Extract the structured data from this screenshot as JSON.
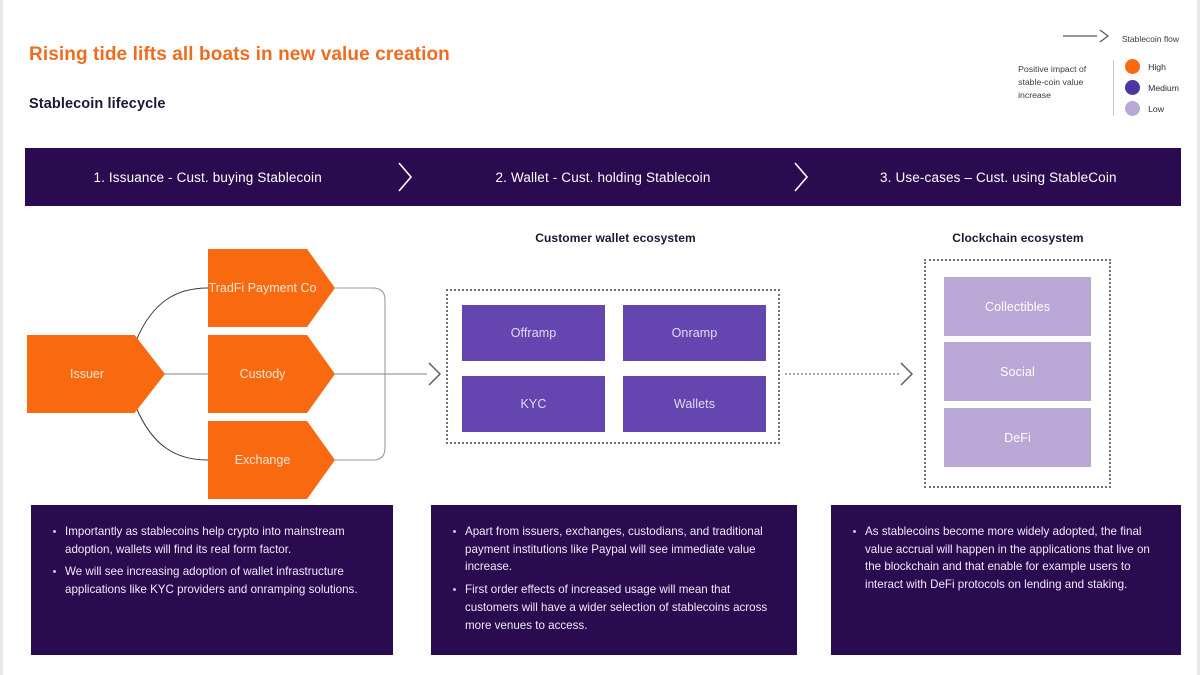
{
  "header": {
    "title": "Rising tide lifts all boats in new value creation",
    "subtitle": "Stablecoin lifecycle"
  },
  "legend": {
    "flow_label": "Stablecoin flow",
    "flow_icon": "arrow-right-chevron-icon",
    "impact_caption": "Positive impact of stable-coin value increase",
    "keys": [
      {
        "label": "High",
        "color": "#f96a10",
        "icon": "circle-icon"
      },
      {
        "label": "Medium",
        "color": "#50359e",
        "icon": "circle-icon"
      },
      {
        "label": "Low",
        "color": "#b9a8d5",
        "icon": "circle-icon"
      }
    ]
  },
  "banner": {
    "background": "#2b0b50",
    "stages": [
      "1. Issuance - Cust. buying Stablecoin",
      "2. Wallet - Cust. holding Stablecoin",
      "3. Use-cases – Cust. using StableCoin"
    ],
    "separator_icon": "chevron-right-icon"
  },
  "diagram": {
    "stage1": {
      "source": {
        "label": "Issuer",
        "color": "#f96a10"
      },
      "targets": [
        {
          "label": "TradFi Payment Co",
          "color": "#f96a10"
        },
        {
          "label": "Custody",
          "color": "#f96a10"
        },
        {
          "label": "Exchange",
          "color": "#f96a10"
        }
      ]
    },
    "stage2": {
      "heading": "Customer wallet ecosystem",
      "tiles": [
        {
          "label": "Offramp",
          "color": "#6546b0"
        },
        {
          "label": "Onramp",
          "color": "#6546b0"
        },
        {
          "label": "KYC",
          "color": "#6546b0"
        },
        {
          "label": "Wallets",
          "color": "#6546b0"
        }
      ]
    },
    "stage3": {
      "heading": "Clockchain ecosystem",
      "tiles": [
        {
          "label": "Collectibles",
          "color": "#b9a8d5"
        },
        {
          "label": "Social",
          "color": "#b9a8d5"
        },
        {
          "label": "DeFi",
          "color": "#b9a8d5"
        }
      ]
    }
  },
  "notes": [
    {
      "bullets": [
        "Importantly as stablecoins help crypto into mainstream adoption, wallets will find its real form factor.",
        "We will see increasing adoption of wallet infrastructure applications like KYC providers and onramping solutions."
      ]
    },
    {
      "bullets": [
        "Apart from issuers, exchanges, custodians, and traditional payment institutions like Paypal will see immediate value increase.",
        "First order effects of increased usage will mean that customers will have a wider selection of stablecoins across more venues to access."
      ]
    },
    {
      "bullets": [
        "As stablecoins become more widely adopted, the final value accrual will happen in the applications that live on the blockchain and that enable for example users to interact with DeFi protocols on lending and staking."
      ]
    }
  ]
}
